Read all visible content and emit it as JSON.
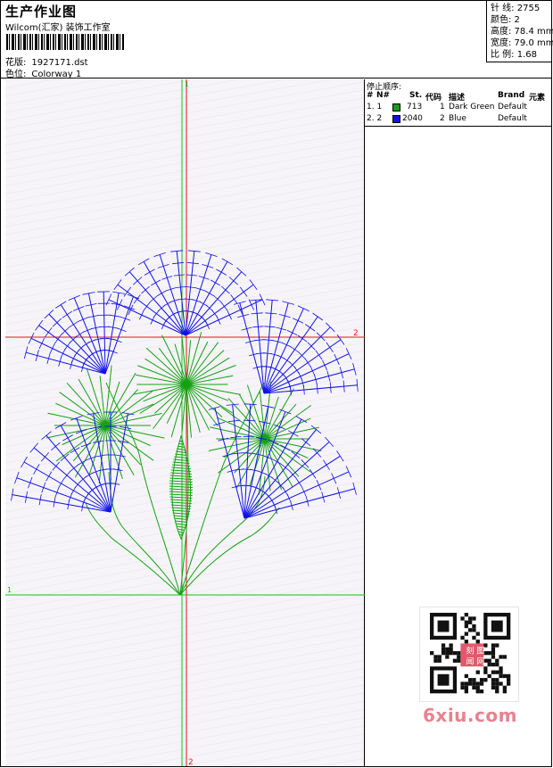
{
  "header": {
    "title": "生产作业图",
    "subtitle": "Wilcom(汇家) 装饰工作室",
    "design_label": "花版:",
    "design_file": "1927171.dst",
    "colorway_label": "色位:",
    "colorway": "Colorway 1"
  },
  "stats": {
    "stitches": "针 线: 2755",
    "colors": "颜色: 2",
    "height": "高度: 78.4 mm",
    "width": "宽度: 79.0 mm",
    "scale": "比 例: 1.68"
  },
  "design": {
    "guide_labels": {
      "top": "1",
      "left": "1",
      "right": "2",
      "bottom": "2"
    },
    "colors": {
      "green": "#14a014",
      "blue": "#1010e8",
      "guide_green": "#18c018",
      "guide_red": "#e01818"
    }
  },
  "thread_panel": {
    "title": "停止顺序:",
    "headers": {
      "num": "#",
      "no": "N#",
      "st": "St.",
      "code": "代码",
      "desc": "描述",
      "brand": "Brand",
      "elem": "元素"
    },
    "rows": [
      {
        "num": "1. 1",
        "color": "#1a9c1a",
        "st": "713",
        "code": "1",
        "desc": "Dark Green",
        "brand": "Default"
      },
      {
        "num": "2. 2",
        "color": "#1010ee",
        "st": "2040",
        "code": "2",
        "desc": "Blue",
        "brand": "Default"
      }
    ]
  },
  "watermark": {
    "text": "6xiu.com",
    "seal": "刻 图 闻 网"
  }
}
